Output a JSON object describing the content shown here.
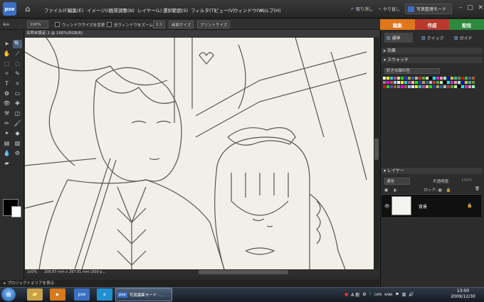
{
  "app": {
    "logo_text": "pse",
    "mode_button": "写真整理モード"
  },
  "menu": [
    "ファイル(F)",
    "編集(E)",
    "イメージ(I)",
    "画質調整(N)",
    "レイヤー(L)",
    "選択範囲(S)",
    "フィルタ(T)",
    "ビュー(V)",
    "ウィンドウ(W)",
    "ヘルプ(H)"
  ],
  "history": {
    "undo": "取り消し",
    "redo": "やり直し"
  },
  "options": {
    "zoom": "100%",
    "resize_windows": "ウィンドウサイズを変更",
    "zoom_all": "全ウィンドウをズーム",
    "actual": "1:1",
    "fit_screen": "画面サイズ",
    "print_size": "プリントサイズ"
  },
  "mode_tabs": [
    {
      "label": "編集",
      "color": "#e0761a"
    },
    {
      "label": "作成",
      "color": "#c0392b"
    },
    {
      "label": "配信",
      "color": "#2e8b3d"
    }
  ],
  "panel_tabs": {
    "standard": "標準",
    "quick": "クイック",
    "guide": "ガイド"
  },
  "document": {
    "title": "名称未設定-1 @ 100%(RGB/8)",
    "status_zoom": "100%",
    "status_size": "209.97 mm x 297.01 mm (300 p..."
  },
  "project_bin": "プロジェクトエリアを表示",
  "panels": {
    "effects": "効果",
    "swatches": "スウォッチ",
    "swatch_set": "好きな緑の色",
    "layers": "レイヤー"
  },
  "layers": {
    "blend": "通常",
    "opacity_label": "不透明度:",
    "opacity": "100%",
    "lock": "ロック:",
    "items": [
      {
        "name": "背景"
      }
    ]
  },
  "taskbar": {
    "active_task": "写真編集モード - ...",
    "ime": "A 般",
    "caps": "CAPS",
    "kana": "KANA",
    "time": "13:00",
    "date": "2009/12/30"
  },
  "colors": {
    "accent_blue": "#3a6fc4",
    "panel_bg": "#2c2c2c"
  }
}
